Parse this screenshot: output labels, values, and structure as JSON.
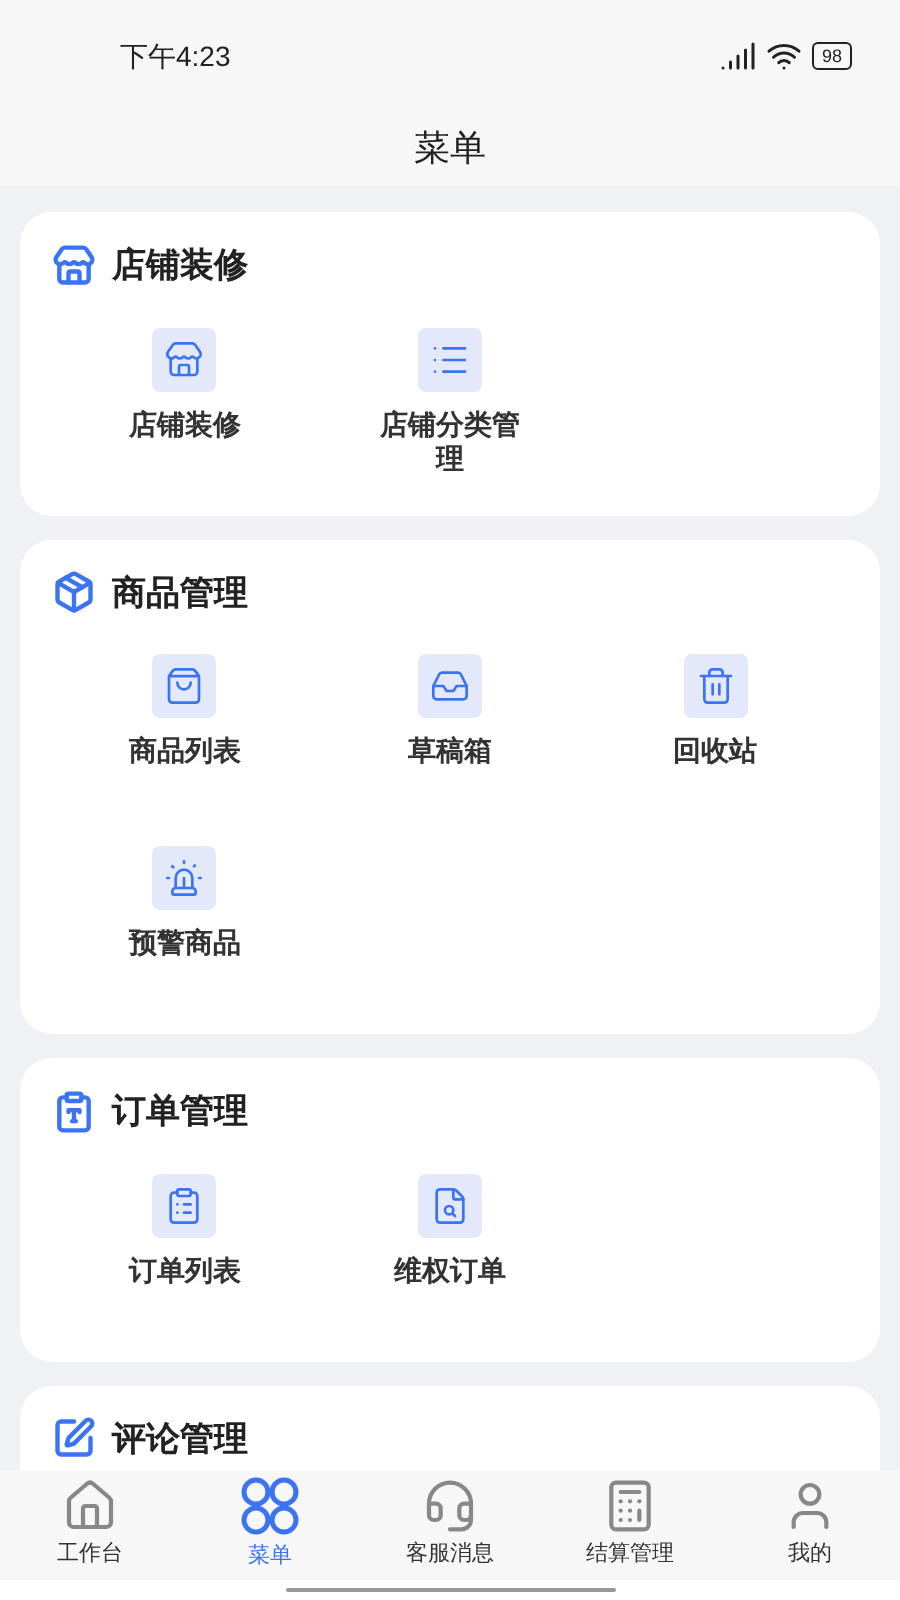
{
  "status_bar": {
    "time": "下午4:23",
    "battery": "98"
  },
  "title": "菜单",
  "sections": [
    {
      "title": "店铺装修",
      "items": [
        "店铺装修",
        "店铺分类管理"
      ]
    },
    {
      "title": "商品管理",
      "items": [
        "商品列表",
        "草稿箱",
        "回收站",
        "预警商品"
      ]
    },
    {
      "title": "订单管理",
      "items": [
        "订单列表",
        "维权订单"
      ]
    },
    {
      "title": "评论管理"
    }
  ],
  "tab_bar": [
    {
      "label": "工作台",
      "selected": false
    },
    {
      "label": "菜单",
      "selected": true
    },
    {
      "label": "客服消息",
      "selected": false
    },
    {
      "label": "结算管理",
      "selected": false
    },
    {
      "label": "我的",
      "selected": false
    }
  ]
}
